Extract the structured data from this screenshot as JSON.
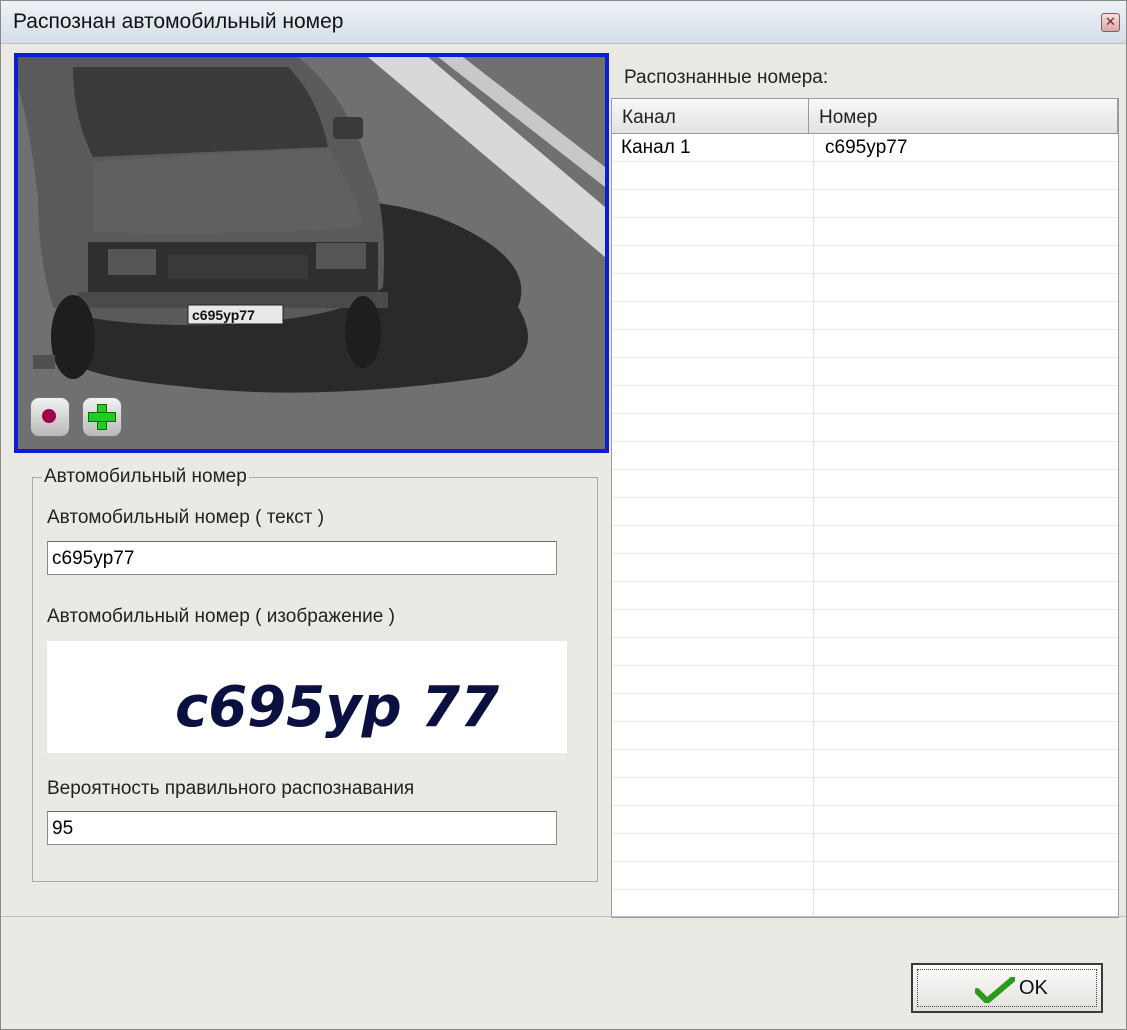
{
  "window": {
    "title": "Распознан автомобильный номер"
  },
  "camera": {
    "plate_overlay_text": "с695ур77",
    "buttons": [
      {
        "name": "record-button",
        "icon": "record-icon"
      },
      {
        "name": "add-button",
        "icon": "plus-icon"
      }
    ]
  },
  "plate_group": {
    "title": "Автомобильный номер",
    "text_label": "Автомобильный номер ( текст )",
    "text_value": "c695yp77",
    "image_label": "Автомобильный номер ( изображение )",
    "image_text": "c695yp 77",
    "probability_label": "Вероятность правильного распознавания",
    "probability_value": "95"
  },
  "recognized": {
    "label": "Распознанные номера:",
    "columns": [
      "Канал",
      "Номер"
    ],
    "rows": [
      {
        "channel": "Канал 1",
        "number": "c695yp77"
      }
    ]
  },
  "ok_button": {
    "label": "OK"
  },
  "colors": {
    "camera_border": "#0a1fd0",
    "ok_check": "#2a9a1a",
    "plate_ink": "#0a1040"
  }
}
